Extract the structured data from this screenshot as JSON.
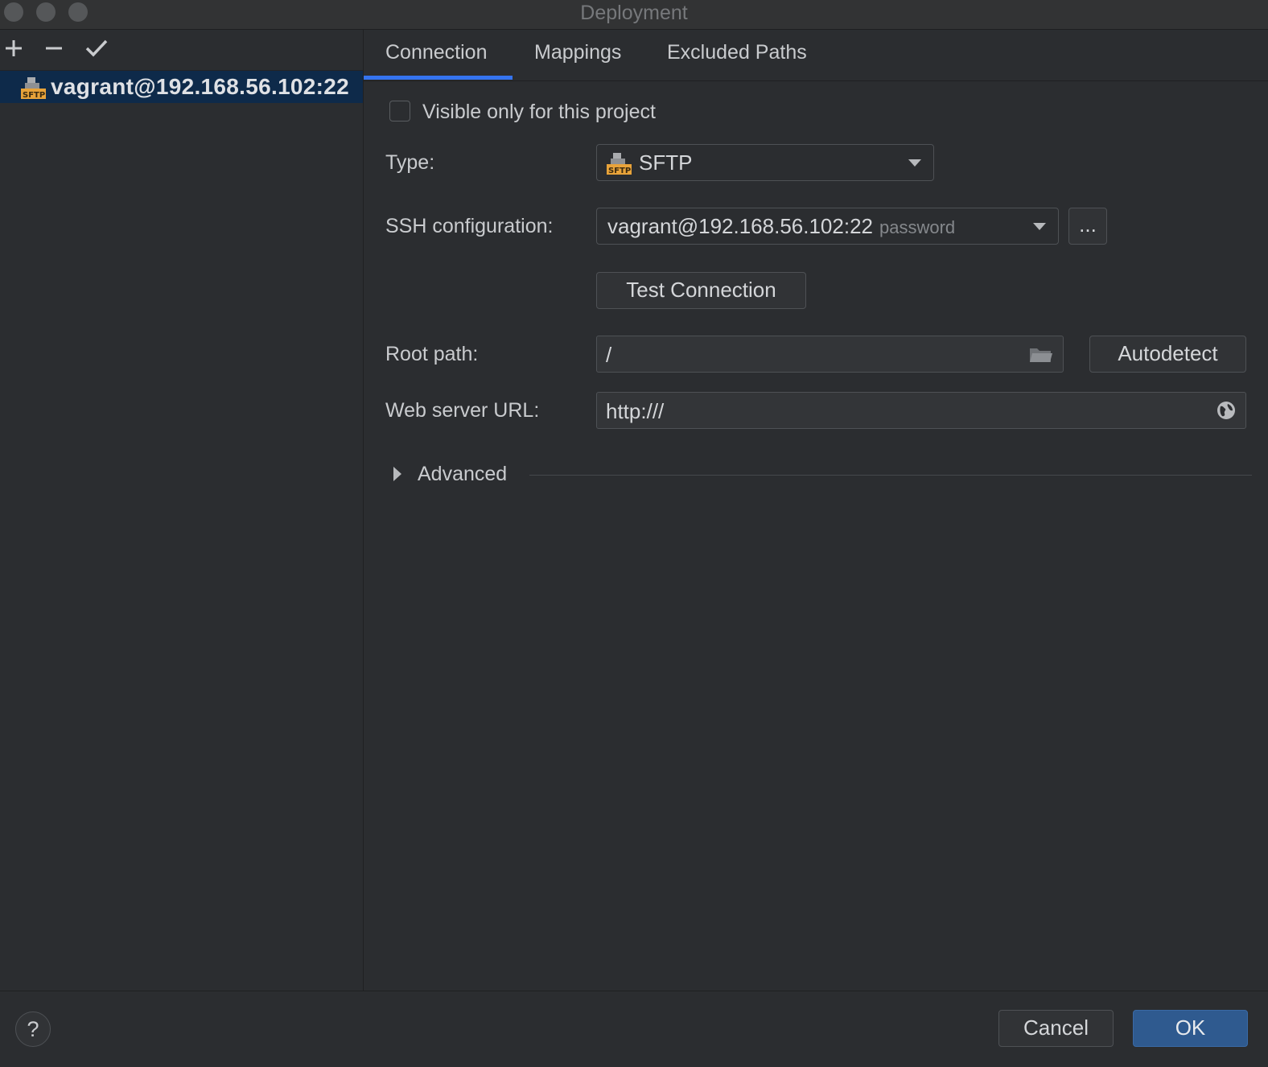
{
  "window": {
    "title": "Deployment"
  },
  "toolbar": {
    "add_icon": "plus-icon",
    "remove_icon": "minus-icon",
    "apply_icon": "check-icon"
  },
  "servers": [
    {
      "label": "vagrant@192.168.56.102:22",
      "icon": "sftp-icon"
    }
  ],
  "tabs": [
    {
      "label": "Connection",
      "active": true
    },
    {
      "label": "Mappings",
      "active": false
    },
    {
      "label": "Excluded Paths",
      "active": false
    }
  ],
  "form": {
    "visible_only_label": "Visible only for this project",
    "visible_only_checked": false,
    "type_label": "Type:",
    "type_value": "SFTP",
    "ssh_label": "SSH configuration:",
    "ssh_value": "vagrant@192.168.56.102:22",
    "ssh_hint": "password",
    "ssh_more_label": "...",
    "test_connection_label": "Test Connection",
    "root_path_label": "Root path:",
    "root_path_value": "/",
    "autodetect_label": "Autodetect",
    "web_url_label": "Web server URL:",
    "web_url_value": "http:///",
    "advanced_label": "Advanced"
  },
  "footer": {
    "help_label": "?",
    "cancel_label": "Cancel",
    "ok_label": "OK"
  },
  "colors": {
    "accent": "#3574f0",
    "selection": "#0e2a4a",
    "ok_button": "#2f5a8f",
    "sftp_orange": "#e8a33a"
  }
}
